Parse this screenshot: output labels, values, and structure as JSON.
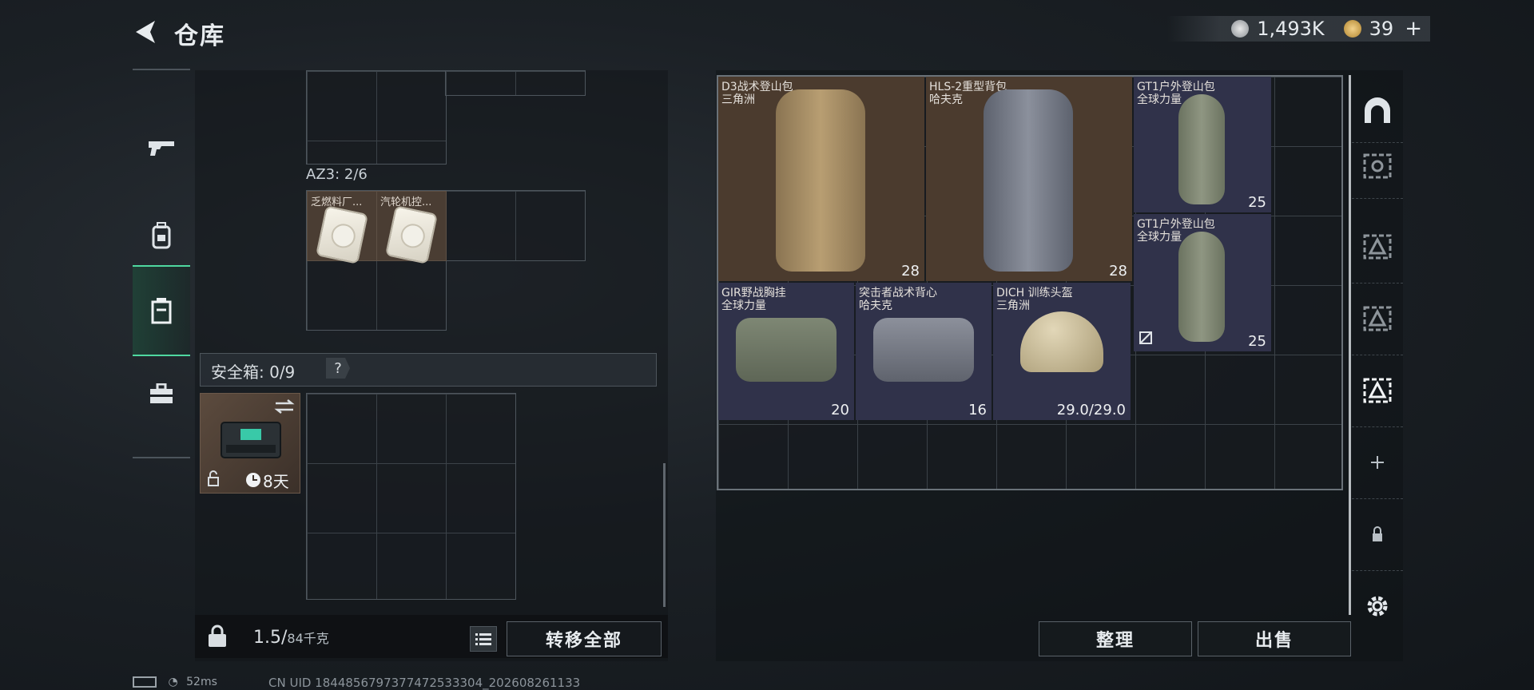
{
  "header": {
    "title": "仓库"
  },
  "currency": {
    "coins": "1,493K",
    "gems": "39",
    "plus": "+"
  },
  "left_rail": {
    "items": [
      "gun-icon",
      "backpack-icon",
      "locker-icon",
      "toolbox-icon"
    ]
  },
  "container": {
    "label": "AZ3: 2/6",
    "items": [
      {
        "name": "乏燃料厂..."
      },
      {
        "name": "汽轮机控..."
      }
    ]
  },
  "safe_box": {
    "label": "安全箱: 0/9",
    "help": "?",
    "time": "8天"
  },
  "bottom": {
    "weight_value": "1.5/",
    "weight_max": "84千克",
    "transfer_all": "转移全部"
  },
  "storage": {
    "items": [
      {
        "name": "D3战术登山包",
        "brand": "三角洲",
        "value": "28"
      },
      {
        "name": "HLS-2重型背包",
        "brand": "哈夫克",
        "value": "28"
      },
      {
        "name": "GT1户外登山包",
        "brand": "全球力量",
        "value": "25"
      },
      {
        "name": "GT1户外登山包",
        "brand": "全球力量",
        "value": "25"
      },
      {
        "name": "GIR野战胸挂",
        "brand": "全球力量",
        "value": "20"
      },
      {
        "name": "突击者战术背心",
        "brand": "哈夫克",
        "value": "16"
      },
      {
        "name": "DICH 训练头盔",
        "brand": "三角洲",
        "value": "29.0/29.0"
      }
    ],
    "sort": "整理",
    "sell": "出售"
  },
  "status": {
    "ping": "52ms",
    "uid": "CN UID 1844856797377472533304_202608261133"
  }
}
